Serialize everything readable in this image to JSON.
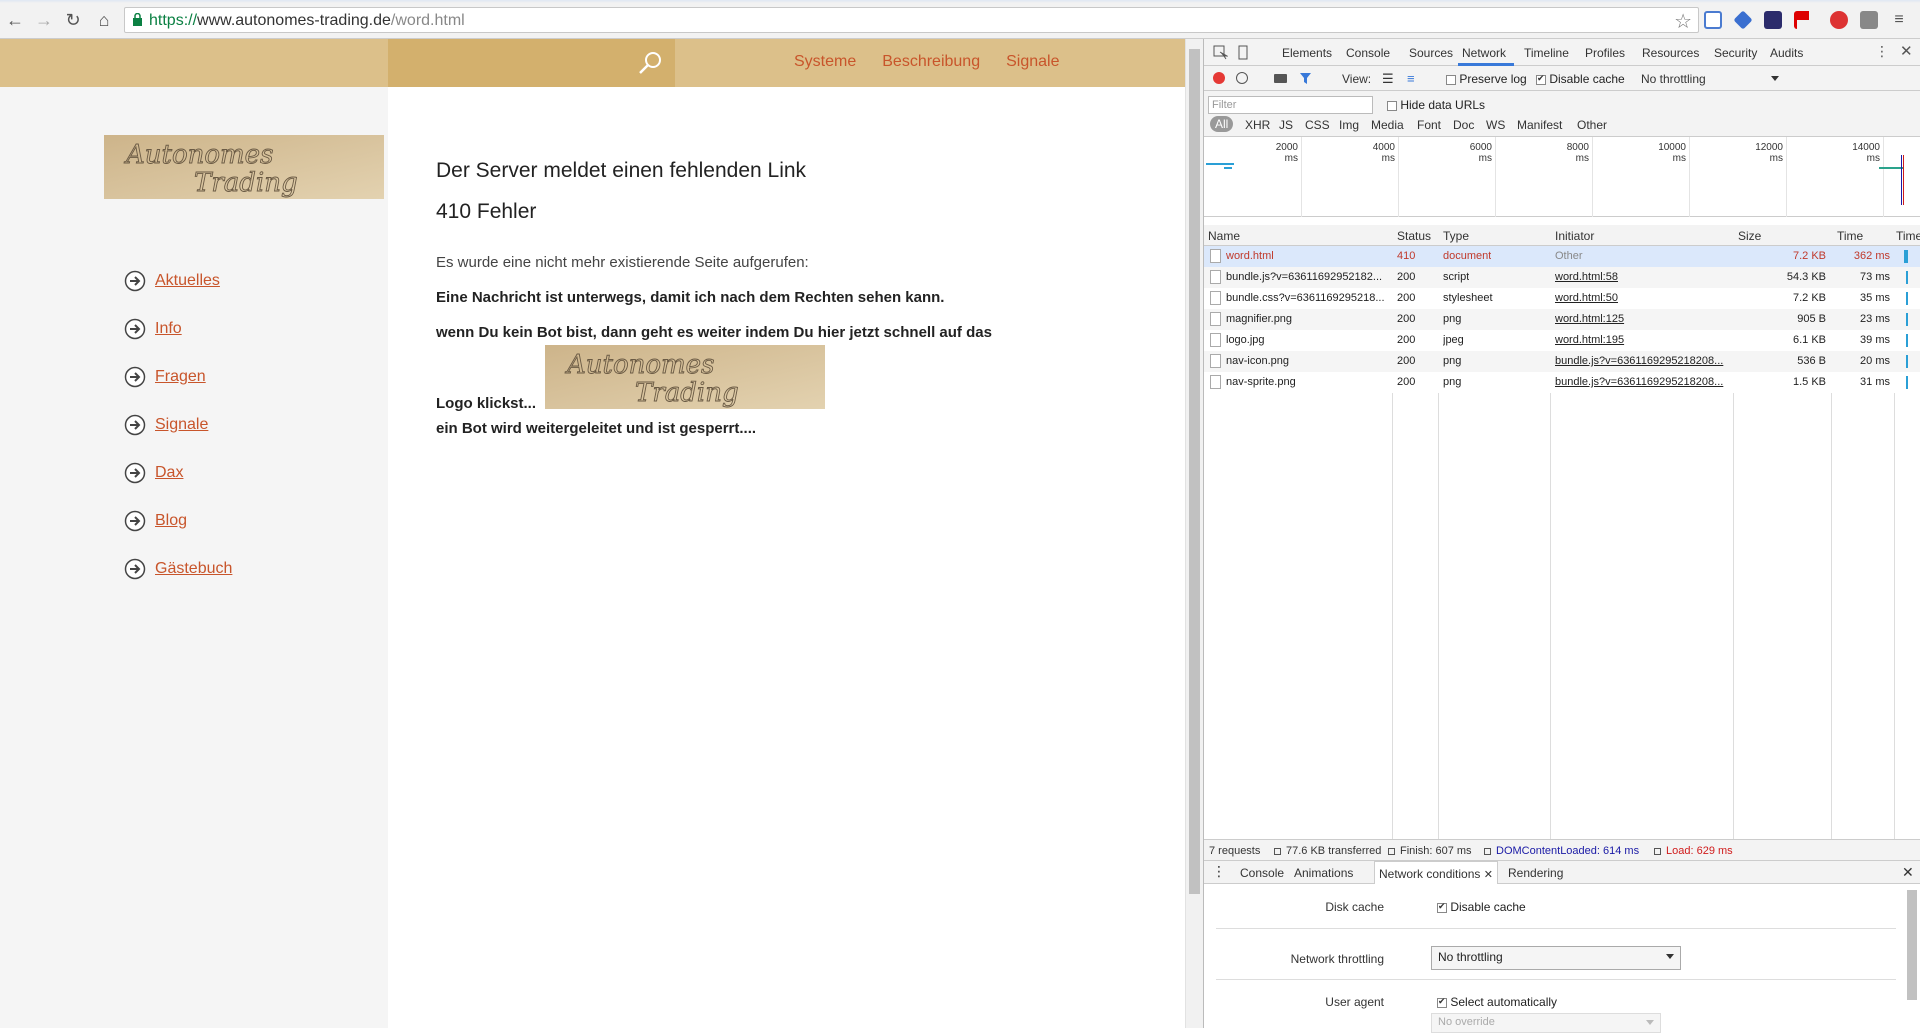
{
  "browser": {
    "url_scheme": "https://",
    "url_host": "www.autonomes-trading.de",
    "url_path": "/word.html"
  },
  "site": {
    "topnav": [
      "Systeme",
      "Beschreibung",
      "Signale"
    ],
    "sidenav": [
      "Aktuelles",
      "Info",
      "Fragen",
      "Signale",
      "Dax",
      "Blog",
      "Gästebuch"
    ],
    "logo_text_line1": "Autonomes",
    "logo_text_line2": "Trading",
    "heading": "Der Server meldet einen fehlenden Link",
    "error_code": "410 Fehler",
    "para1": "Es wurde eine nicht mehr existierende Seite aufgerufen:",
    "para2": "Eine Nachricht ist unterwegs, damit ich nach dem Rechten sehen kann.",
    "para3": "wenn Du kein Bot bist, dann geht es weiter indem Du hier jetzt schnell auf das",
    "para4": "Logo klickst...",
    "para5": "ein Bot wird weitergeleitet und ist gesperrt...."
  },
  "devtools": {
    "tabs": [
      "Elements",
      "Console",
      "Sources",
      "Network",
      "Timeline",
      "Profiles",
      "Resources",
      "Security",
      "Audits"
    ],
    "active_tab": "Network",
    "toolbar": {
      "view_label": "View:",
      "preserve_log": "Preserve log",
      "disable_cache": "Disable cache",
      "throttling": "No throttling"
    },
    "filter": {
      "placeholder": "Filter",
      "hide_data_urls": "Hide data URLs",
      "types": [
        "All",
        "XHR",
        "JS",
        "CSS",
        "Img",
        "Media",
        "Font",
        "Doc",
        "WS",
        "Manifest",
        "Other"
      ]
    },
    "overview_ticks": [
      "2000 ms",
      "4000 ms",
      "6000 ms",
      "8000 ms",
      "10000 ms",
      "12000 ms",
      "14000 ms"
    ],
    "columns": [
      "Name",
      "Status",
      "Type",
      "Initiator",
      "Size",
      "Time",
      "Timeline"
    ],
    "requests": [
      {
        "name": "word.html",
        "status": "410",
        "type": "document",
        "initiator": "Other",
        "size": "7.2 KB",
        "time": "362 ms"
      },
      {
        "name": "bundle.js?v=63611692952182...",
        "status": "200",
        "type": "script",
        "initiator": "word.html:58",
        "size": "54.3 KB",
        "time": "73 ms"
      },
      {
        "name": "bundle.css?v=6361169295218...",
        "status": "200",
        "type": "stylesheet",
        "initiator": "word.html:50",
        "size": "7.2 KB",
        "time": "35 ms"
      },
      {
        "name": "magnifier.png",
        "status": "200",
        "type": "png",
        "initiator": "word.html:125",
        "size": "905 B",
        "time": "23 ms"
      },
      {
        "name": "logo.jpg",
        "status": "200",
        "type": "jpeg",
        "initiator": "word.html:195",
        "size": "6.1 KB",
        "time": "39 ms"
      },
      {
        "name": "nav-icon.png",
        "status": "200",
        "type": "png",
        "initiator": "bundle.js?v=6361169295218208...",
        "size": "536 B",
        "time": "20 ms"
      },
      {
        "name": "nav-sprite.png",
        "status": "200",
        "type": "png",
        "initiator": "bundle.js?v=6361169295218208...",
        "size": "1.5 KB",
        "time": "31 ms"
      }
    ],
    "summary": {
      "requests": "7 requests",
      "transferred": "77.6 KB transferred",
      "finish": "Finish: 607 ms",
      "dcl": "DOMContentLoaded: 614 ms",
      "load": "Load: 629 ms"
    },
    "drawer": {
      "tabs": [
        "Console",
        "Animations",
        "Network conditions",
        "Rendering"
      ],
      "active_tab": "Network conditions",
      "disk_cache_label": "Disk cache",
      "disk_cache_option": "Disable cache",
      "throttling_label": "Network throttling",
      "throttling_value": "No throttling",
      "user_agent_label": "User agent",
      "user_agent_option": "Select automatically",
      "user_agent_override": "No override"
    }
  },
  "colors": {
    "site_link": "#c8552b",
    "topbar": "#dcc08a",
    "error_row": "#c0392b",
    "devtools_accent": "#3879d9",
    "dcl": "#1a1aa6",
    "load": "#d01b1b"
  }
}
